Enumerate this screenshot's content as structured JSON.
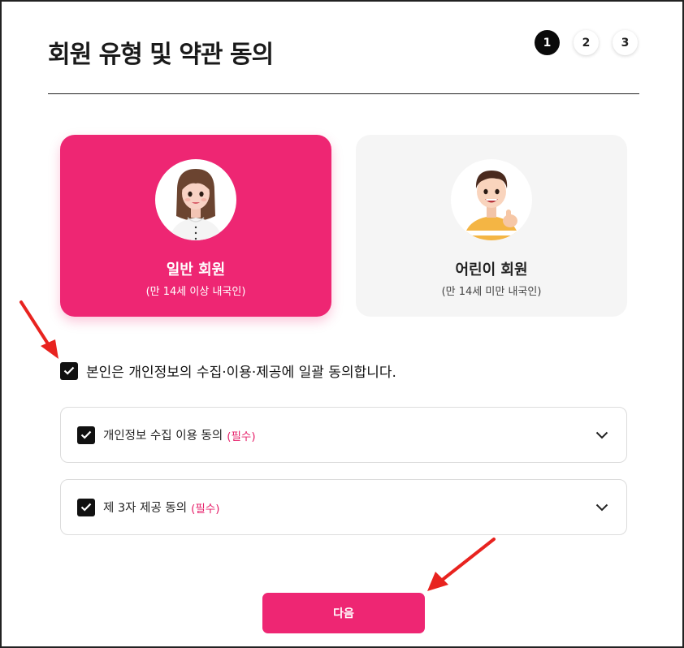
{
  "header": {
    "title": "회원 유형 및 약관 동의",
    "steps": [
      "1",
      "2",
      "3"
    ],
    "active_step": "1"
  },
  "member_types": [
    {
      "name": "일반 회원",
      "sub": "(만 14세 이상 내국인)",
      "selected": true,
      "avatar": "woman-avatar"
    },
    {
      "name": "어린이 회원",
      "sub": "(만 14세 미만 내국인)",
      "selected": false,
      "avatar": "boy-avatar"
    }
  ],
  "agree_all": {
    "label": "본인은 개인정보의 수집·이용·제공에 일괄 동의합니다.",
    "checked": true
  },
  "agreements": [
    {
      "label": "개인정보 수집 이용 동의",
      "required": "(필수)",
      "checked": true
    },
    {
      "label": "제 3자 제공 동의",
      "required": "(필수)",
      "checked": true
    }
  ],
  "next_button": {
    "label": "다음"
  },
  "colors": {
    "accent": "#ee2673",
    "required": "#e6206a",
    "check": "#111111",
    "annotation_arrow": "#e8231f"
  }
}
